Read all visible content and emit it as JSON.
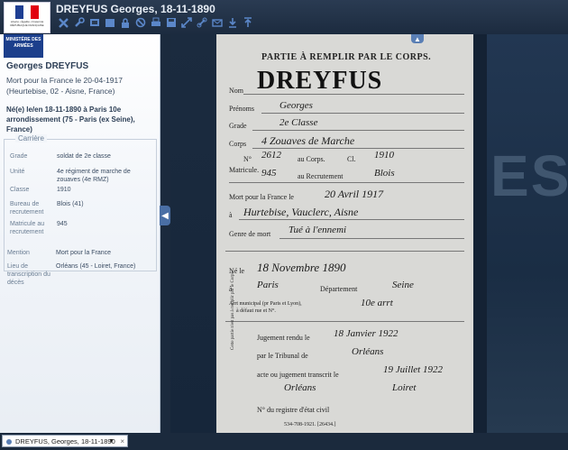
{
  "header": {
    "title": "DREYFUS Georges, 18-11-1890",
    "logo_text": "Liberté • Égalité • Fraternité RÉPUBLIQUE FRANÇAISE",
    "toolbar": [
      "close-icon",
      "tools-icon",
      "filmstrip-icon",
      "page-icon",
      "lock-icon",
      "ban-icon",
      "print-icon",
      "save-icon",
      "resize-icon",
      "link-icon",
      "mail-icon",
      "download-icon",
      "upload-icon"
    ]
  },
  "sidebar": {
    "ministere": "MINISTÈRE DES ARMÉES",
    "name": "Georges DREYFUS",
    "mort": "Mort pour la France le 20-04-1917 (Heurtebise, 02 - Aisne, France)",
    "ne": "Né(e) le/en 18-11-1890 à Paris 10e arrondissement (75 - Paris (ex Seine), France)",
    "carriere_legend": "Carrière",
    "grade_label": "Grade",
    "grade_value": "soldat de 2e classe",
    "unite_label": "Unité",
    "unite_value": "4e régiment de marche de zouaves (4e RMZ)",
    "classe_label": "Classe",
    "classe_value": "1910",
    "bureau_label": "Bureau de recrutement",
    "bureau_value": "Blois (41)",
    "matricule_label": "Matricule au recrutement",
    "matricule_value": "945",
    "mention_label": "Mention",
    "mention_value": "Mort pour la France",
    "lieu_label": "Lieu de transcription du décès",
    "lieu_value": "Orléans (45 - Loiret, France)"
  },
  "document": {
    "header": "PARTIE À REMPLIR PAR LE CORPS.",
    "big_name": "DREYFUS",
    "nom": "Nom",
    "prenoms": "Prénoms",
    "prenoms_hw": "Georges",
    "grade": "Grade",
    "grade_hw": "2e Classe",
    "corps": "Corps",
    "corps_hw": "4 Zouaves de Marche",
    "no": "N°",
    "matricule": "Matricule.",
    "au_corps": "au Corps.",
    "cl": "Cl.",
    "corps_num": "2612",
    "cl_hw": "1910",
    "au_recrutement": "au Recrutement",
    "recr_num": "945",
    "recr_hw": "Blois",
    "mort_pf": "Mort pour la France le",
    "mort_date": "20 Avril 1917",
    "a_label": "à",
    "mort_lieu": "Hurtebise, Vauclerc, Aisne",
    "genre": "Genre de mort",
    "genre_hw": "Tué à l'ennemi",
    "ne_le": "Né le",
    "ne_date": "18 Novembre 1890",
    "ne_a": "à",
    "ne_lieu": "Paris",
    "departement": "Département",
    "dep_hw": "Seine",
    "arr": "Arrt municipal (pr Paris et Lyon),",
    "arr2": "à défaut rue et N°.",
    "arr_hw": "10e arrt",
    "side_note": "Cette partie n'est pas à remplir par le Corps.",
    "jug": "Jugement rendu le",
    "jug_hw": "18 Janvier 1922",
    "trib": "par le Tribunal de",
    "trib_hw": "Orléans",
    "transcrit": "acte ou jugement transcrit le",
    "transcrit_hw": "19 Juillet 1922",
    "orl_hw": "Orléans",
    "loiret_hw": "Loiret",
    "registre": "N° du registre d'état civil",
    "footer": "534-708-1921. [26434.]"
  },
  "background": {
    "big_text": "ES"
  },
  "bottom": {
    "select_value": "DREYFUS, Georges, 18-11-1890"
  }
}
